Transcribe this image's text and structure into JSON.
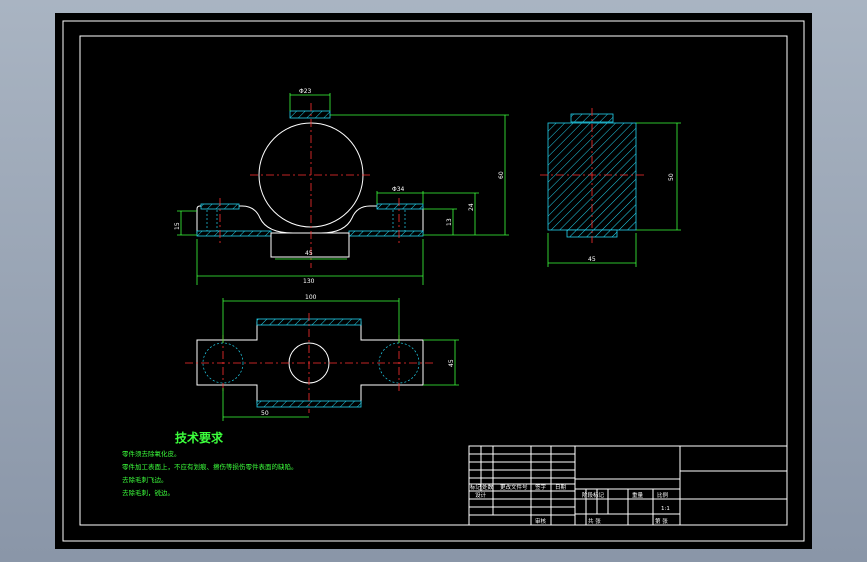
{
  "drawing": {
    "dims": {
      "top_dia": "Φ23",
      "boss_dia": "Φ34",
      "width_15": "15",
      "base_45": "45",
      "height_13": "13",
      "height_24": "24",
      "height_60": "60",
      "length_130": "130",
      "length_100": "100",
      "width_50": "50",
      "side_width": "50",
      "side_height": "45",
      "side_depth": "45"
    },
    "notes": {
      "title": "技术要求",
      "lines": [
        "零件须去除氧化皮。",
        "零件加工表面上，不应有划痕、擦伤等损伤零件表面的缺陷。",
        "去除毛刺飞边。",
        "去除毛刺，锐边。"
      ]
    },
    "title_block": {
      "row_labels": [
        "标记",
        "处数",
        "更改文件号",
        "签字",
        "日期"
      ],
      "design": "设计",
      "stage": "阶段标记",
      "weight": "重量",
      "scale": "比例",
      "scale_value": "1:1",
      "approve": "审核",
      "date": "日期",
      "sheet_total": "共 张",
      "sheet_no": "第 张"
    }
  }
}
